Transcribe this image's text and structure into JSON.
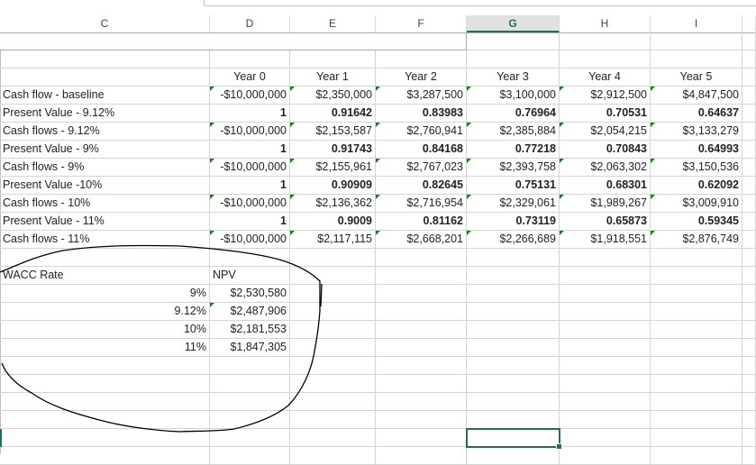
{
  "columns": [
    "C",
    "D",
    "E",
    "F",
    "G",
    "H",
    "I"
  ],
  "active_column": "G",
  "year_headers": [
    "Year 0",
    "Year 1",
    "Year 2",
    "Year 3",
    "Year 4",
    "Year 5"
  ],
  "rows": [
    {
      "label": "Cash flow - baseline",
      "bold": false,
      "values": [
        "-$10,000,000",
        "$2,350,000",
        "$3,287,500",
        "$3,100,000",
        "$2,912,500",
        "$4,847,500"
      ]
    },
    {
      "label": "Present Value - 9.12%",
      "bold": true,
      "values": [
        "1",
        "0.91642",
        "0.83983",
        "0.76964",
        "0.70531",
        "0.64637"
      ]
    },
    {
      "label": "Cash flows - 9.12%",
      "bold": false,
      "values": [
        "-$10,000,000",
        "$2,153,587",
        "$2,760,941",
        "$2,385,884",
        "$2,054,215",
        "$3,133,279"
      ]
    },
    {
      "label": "Present Value - 9%",
      "bold": true,
      "values": [
        "1",
        "0.91743",
        "0.84168",
        "0.77218",
        "0.70843",
        "0.64993"
      ]
    },
    {
      "label": "Cash flows - 9%",
      "bold": false,
      "values": [
        "-$10,000,000",
        "$2,155,961",
        "$2,767,023",
        "$2,393,758",
        "$2,063,302",
        "$3,150,536"
      ]
    },
    {
      "label": "Present Value -10%",
      "bold": true,
      "values": [
        "1",
        "0.90909",
        "0.82645",
        "0.75131",
        "0.68301",
        "0.62092"
      ]
    },
    {
      "label": "Cash flows - 10%",
      "bold": false,
      "values": [
        "-$10,000,000",
        "$2,136,362",
        "$2,716,954",
        "$2,329,061",
        "$1,989,267",
        "$3,009,910"
      ]
    },
    {
      "label": "Present Value - 11%",
      "bold": true,
      "values": [
        "1",
        "0.9009",
        "0.81162",
        "0.73119",
        "0.65873",
        "0.59345"
      ]
    },
    {
      "label": "Cash flows - 11%",
      "bold": false,
      "values": [
        "-$10,000,000",
        "$2,117,115",
        "$2,668,201",
        "$2,266,689",
        "$1,918,551",
        "$2,876,749"
      ]
    }
  ],
  "npv_table": {
    "rate_header": "WACC Rate",
    "npv_header": "NPV",
    "rows": [
      {
        "rate": "9%",
        "npv": "$2,530,580"
      },
      {
        "rate": "9.12%",
        "npv": "$2,487,906"
      },
      {
        "rate": "10%",
        "npv": "$2,181,553"
      },
      {
        "rate": "11%",
        "npv": "$1,847,305"
      }
    ]
  },
  "selected_cell": "G24",
  "accent_color": "#217346"
}
